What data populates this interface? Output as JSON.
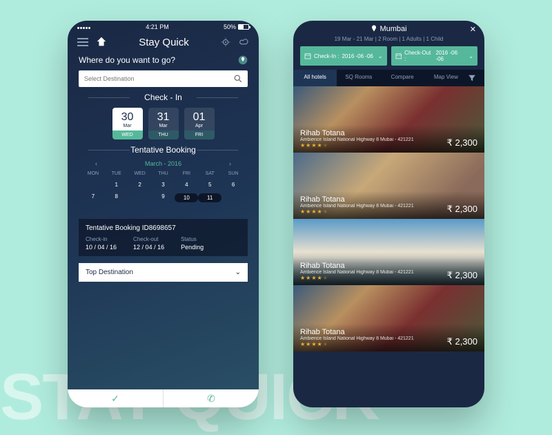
{
  "status": {
    "time": "4:21 PM",
    "battery": "50%"
  },
  "app": {
    "title": "Stay Quick"
  },
  "prompt": "Where do you want to go?",
  "search": {
    "placeholder": "Select Destination"
  },
  "checkin": {
    "label": "Check - In",
    "dates": [
      {
        "num": "30",
        "mon": "Mar",
        "day": "WED"
      },
      {
        "num": "31",
        "mon": "Mar",
        "day": "THU"
      },
      {
        "num": "01",
        "mon": "Apr",
        "day": "FRI"
      }
    ]
  },
  "tentative": {
    "label": "Tentative Booking",
    "month": "March - 2016",
    "dow": [
      "MON",
      "TUE",
      "WED",
      "THU",
      "FRI",
      "SAT",
      "SUN"
    ],
    "weeks": [
      [
        "",
        "1",
        "2",
        "3",
        "4",
        "5",
        "6"
      ],
      [
        "7",
        "8",
        "",
        "9",
        "10",
        "11",
        ""
      ],
      [
        "",
        "",
        "",
        "",
        "",
        "",
        ""
      ],
      [
        "",
        "",
        "",
        "",
        "",
        "",
        ""
      ]
    ],
    "selected": [
      "10",
      "11"
    ]
  },
  "booking": {
    "title": "Tentative Booking ID8698657",
    "cols": [
      {
        "lbl": "Check-in",
        "val": "10 / 04 / 16"
      },
      {
        "lbl": "Check-out",
        "val": "12 / 04 / 16"
      },
      {
        "lbl": "Status",
        "val": "Pending"
      }
    ]
  },
  "topdest": "Top Destination",
  "results": {
    "city": "Mumbai",
    "summary": "19 Mar - 21 Mar | 2 Room | 1 Adults | 1 Child",
    "checkin": {
      "lbl": "Check-In :",
      "val": "2016 -06 -06"
    },
    "checkout": {
      "lbl": "Check-Out :",
      "val": "2016 -06 -06"
    },
    "tabs": [
      "All hotels",
      "SQ Rooms",
      "Compare",
      "Map View"
    ],
    "hotels": [
      {
        "name": "Rihab Totana",
        "addr": "Ambience Island National Highway 8 Mubai - 421221",
        "price": "₹ 2,300"
      },
      {
        "name": "Rihab Totana",
        "addr": "Ambience Island National Highway 8 Mubai - 421221",
        "price": "₹ 2,300"
      },
      {
        "name": "Rihab Totana",
        "addr": "Ambience Island National Highway 8 Mubai - 421221",
        "price": "₹ 2,300"
      },
      {
        "name": "Rihab Totana",
        "addr": "Ambience Island National Highway 8 Mubai - 421221",
        "price": "₹ 2,300"
      }
    ]
  }
}
